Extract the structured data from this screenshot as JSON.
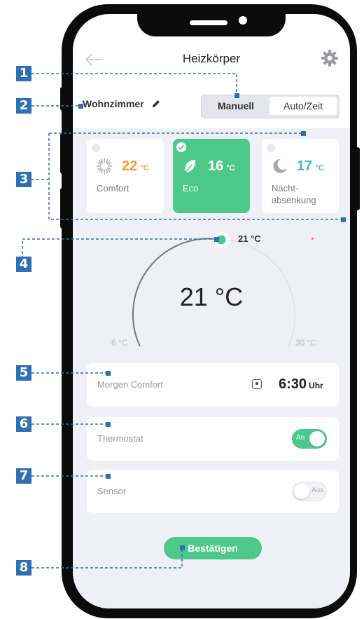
{
  "header": {
    "title": "Heizkörper",
    "back_icon": "arrow-left-icon",
    "settings_icon": "gear-icon"
  },
  "room": {
    "name": "Wohnzimmer",
    "edit_icon": "pencil-icon"
  },
  "mode_toggle": {
    "manual_label": "Manuell",
    "auto_label": "Auto/Zeit",
    "selected": "Manuell"
  },
  "presets": [
    {
      "icon": "sun-icon",
      "temp": "22",
      "unit": "°C",
      "name": "Comfort",
      "color": "#f29a2e",
      "selected": false
    },
    {
      "icon": "leaf-icon",
      "temp": "16",
      "unit": "°C",
      "name": "Eco",
      "color": "#ffffff",
      "selected": true
    },
    {
      "icon": "moon-icon",
      "temp": "17",
      "unit": "°C",
      "name": "Nacht-\nabsenkung",
      "color": "#4aaee8",
      "selected": false
    }
  ],
  "dial": {
    "value": "21 °C",
    "knob_label": "21 °C",
    "min": "6 °C",
    "max": "30 °C",
    "setpoint": 21,
    "min_value": 6,
    "max_value": 30
  },
  "schedule": {
    "label": "Morgen Comfort",
    "time": "6:30",
    "time_unit": "Uhr"
  },
  "thermostat": {
    "label": "Thermostat",
    "state_label": "An",
    "on": true
  },
  "sensor": {
    "label": "Sensor",
    "state_label": "Aus",
    "on": false
  },
  "confirm_label": "Bestätigen",
  "callouts": [
    "1",
    "2",
    "3",
    "4",
    "5",
    "6",
    "7",
    "8"
  ],
  "colors": {
    "accent_green": "#4cc98a",
    "callout_blue": "#2f6fb3",
    "comfort_orange": "#f29a2e",
    "night_blue": "#4aaee8"
  }
}
